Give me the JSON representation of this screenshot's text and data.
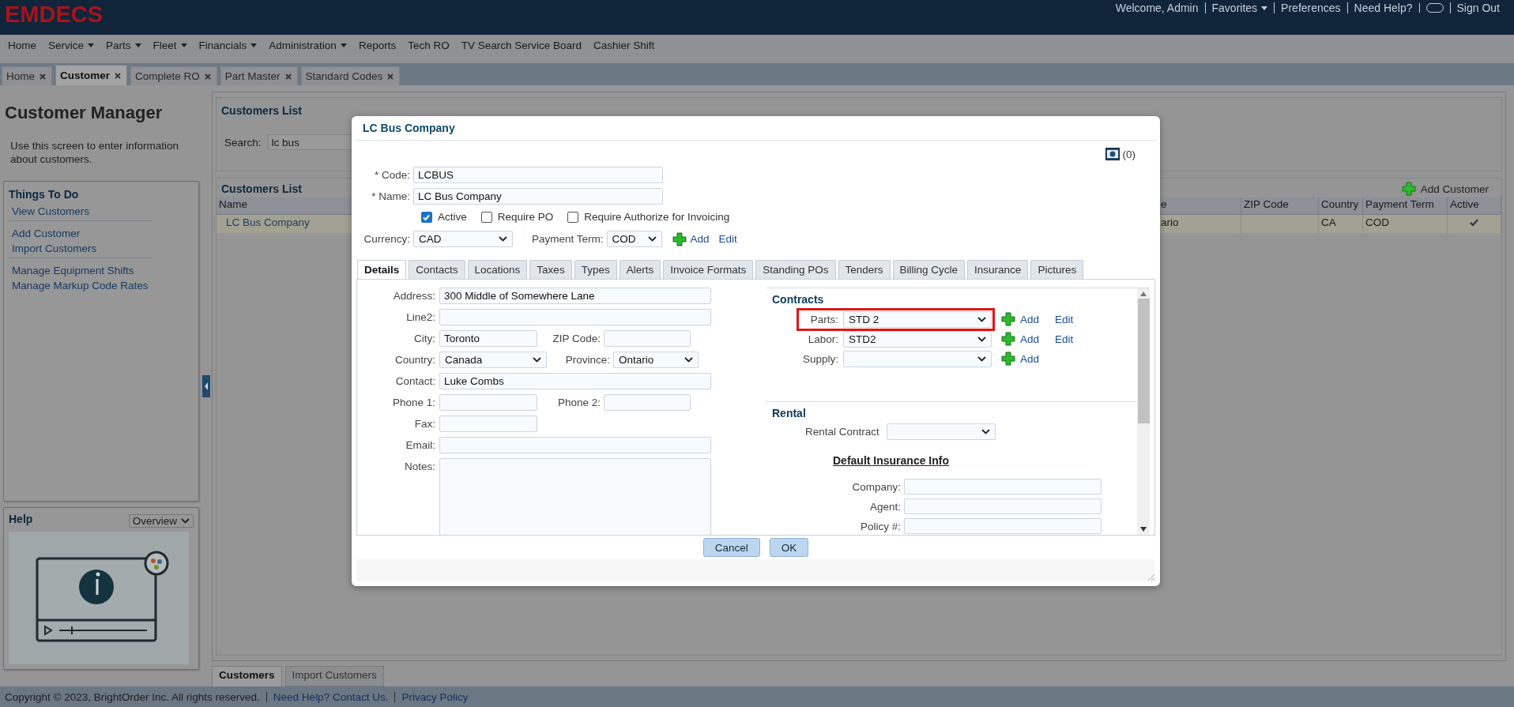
{
  "header": {
    "logo": "EMDECS",
    "welcome": "Welcome, Admin",
    "links": [
      {
        "label": "Favorites",
        "menu": true
      },
      {
        "label": "Preferences",
        "menu": false
      },
      {
        "label": "Need Help?",
        "menu": false
      }
    ],
    "sign_out": "Sign Out"
  },
  "nav": [
    {
      "label": "Home",
      "menu": false
    },
    {
      "label": "Service",
      "menu": true
    },
    {
      "label": "Parts",
      "menu": true
    },
    {
      "label": "Fleet",
      "menu": true
    },
    {
      "label": "Financials",
      "menu": true
    },
    {
      "label": "Administration",
      "menu": true
    },
    {
      "label": "Reports",
      "menu": false
    },
    {
      "label": "Tech RO",
      "menu": false
    },
    {
      "label": "TV Search Service Board",
      "menu": false
    },
    {
      "label": "Cashier Shift",
      "menu": false
    }
  ],
  "page_tabs": [
    {
      "label": "Home",
      "selected": false
    },
    {
      "label": "Customer",
      "selected": true
    },
    {
      "label": "Complete RO",
      "selected": false
    },
    {
      "label": "Part Master",
      "selected": false
    },
    {
      "label": "Standard Codes",
      "selected": false
    }
  ],
  "sidebar": {
    "title": "Customer Manager",
    "description": "Use this screen to enter information about customers.",
    "things_to_do": {
      "title": "Things To Do",
      "groups": [
        [
          "View Customers"
        ],
        [
          "Add Customer",
          "Import Customers"
        ],
        [
          "Manage Equipment Shifts",
          "Manage Markup Code Rates"
        ]
      ]
    },
    "help": {
      "title": "Help",
      "topic": "Overview"
    }
  },
  "search_panel": {
    "title": "Customers List",
    "label": "Search:",
    "value": "lc bus"
  },
  "customers_list": {
    "title": "Customers List",
    "add_button": "Add Customer",
    "columns": [
      "Name",
      "e",
      "ZIP Code",
      "Country",
      "Payment Term",
      "Active"
    ],
    "rows": [
      {
        "name": "LC Bus Company",
        "column_2": "ario",
        "country": "CA",
        "payment_term": "COD",
        "active": true
      }
    ]
  },
  "bottom_tabs": [
    {
      "label": "Customers",
      "selected": true
    },
    {
      "label": "Import Customers",
      "selected": false
    }
  ],
  "footer": {
    "copyright": "Copyright © 2023, BrightOrder Inc. All rights reserved.",
    "links": [
      "Need Help? Contact Us.",
      "Privacy Policy"
    ]
  },
  "dialog": {
    "title": "LC Bus Company",
    "photo_count": "(0)",
    "code": {
      "label": "* Code:",
      "value": "LCBUS"
    },
    "name": {
      "label": "* Name:",
      "value": "LC Bus Company"
    },
    "flags": [
      {
        "label": "Active",
        "checked": true
      },
      {
        "label": "Require PO",
        "checked": false
      },
      {
        "label": "Require Authorize for Invoicing",
        "checked": false
      }
    ],
    "currency": {
      "label": "Currency:",
      "value": "CAD"
    },
    "payment_term": {
      "label": "Payment Term:",
      "value": "COD",
      "add": "Add",
      "edit": "Edit"
    },
    "tabs": [
      {
        "label": "Details",
        "selected": true
      },
      {
        "label": "Contacts",
        "selected": false
      },
      {
        "label": "Locations",
        "selected": false
      },
      {
        "label": "Taxes",
        "selected": false
      },
      {
        "label": "Types",
        "selected": false
      },
      {
        "label": "Alerts",
        "selected": false
      },
      {
        "label": "Invoice Formats",
        "selected": false
      },
      {
        "label": "Standing POs",
        "selected": false
      },
      {
        "label": "Tenders",
        "selected": false
      },
      {
        "label": "Billing Cycle",
        "selected": false
      },
      {
        "label": "Insurance",
        "selected": false
      },
      {
        "label": "Pictures",
        "selected": false
      }
    ],
    "details": [
      [
        {
          "label": "Address:",
          "value": "300 Middle of Somewhere Lane",
          "kind": "text"
        }
      ],
      [
        {
          "label": "Line2:",
          "kind": "text"
        }
      ],
      [
        {
          "label": "City:",
          "value": "Toronto",
          "kind": "short"
        },
        {
          "label": "ZIP Code:",
          "kind": "short"
        }
      ],
      [
        {
          "label": "Country:",
          "value": "Canada",
          "kind": "select"
        },
        {
          "label": "Province:",
          "value": "Ontario",
          "kind": "select"
        }
      ],
      [
        {
          "label": "Contact:",
          "value": "Luke Combs",
          "kind": "text"
        }
      ],
      [
        {
          "label": "Phone 1:",
          "kind": "short"
        },
        {
          "label": "Phone 2:",
          "kind": "short"
        }
      ],
      [
        {
          "label": "Fax:",
          "kind": "short"
        }
      ],
      [
        {
          "label": "Email:",
          "kind": "text"
        }
      ],
      [
        {
          "label": "Notes:",
          "kind": "textarea"
        }
      ]
    ],
    "contracts": {
      "title": "Contracts",
      "rows": [
        {
          "label": "Parts:",
          "value": "STD 2",
          "highlighted": true,
          "add": "Add",
          "edit": "Edit"
        },
        {
          "label": "Labor:",
          "value": "STD2",
          "highlighted": false,
          "add": "Add",
          "edit": "Edit"
        },
        {
          "label": "Supply:",
          "highlighted": false,
          "add": "Add"
        }
      ]
    },
    "rental": {
      "title": "Rental",
      "contract_label": "Rental Contract",
      "insurance_title": "Default Insurance Info",
      "insurance_fields": [
        "Company:",
        "Agent:",
        "Policy #:"
      ]
    },
    "buttons": [
      "Cancel",
      "OK"
    ]
  }
}
